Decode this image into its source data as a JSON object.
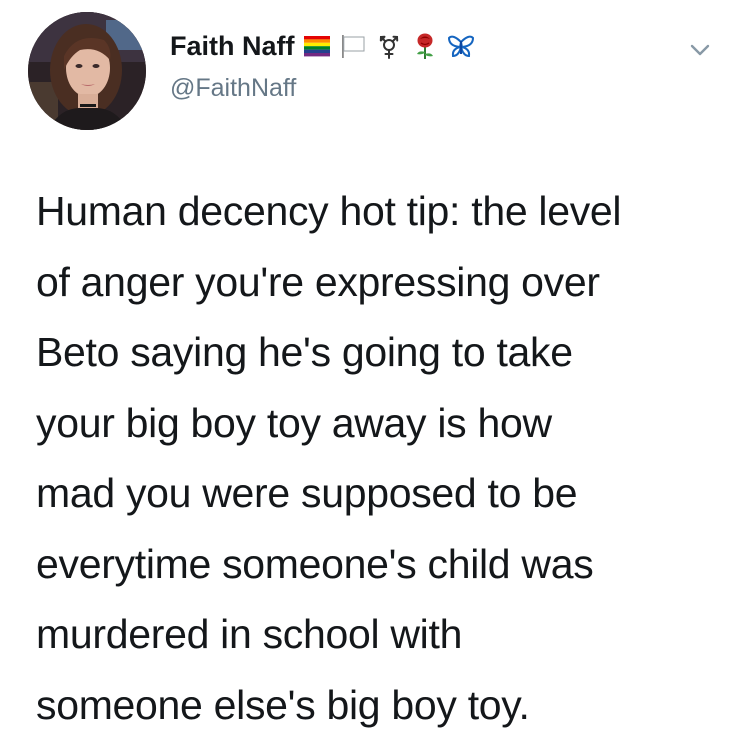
{
  "tweet": {
    "author": {
      "display_name": "Faith Naff",
      "handle": "@FaithNaff",
      "name_emojis": [
        "rainbow-flag-icon",
        "white-flag-icon",
        "transgender-symbol-icon",
        "rose-icon",
        "butterfly-icon"
      ]
    },
    "text_lines": [
      "Human decency hot tip: the level",
      "of anger you're expressing over",
      "Beto saying he's going to take",
      "your big boy toy away is how",
      "mad you were supposed to be",
      "everytime someone's child was",
      "murdered in school with",
      "someone else's big boy toy."
    ]
  },
  "colors": {
    "text": "#14171a",
    "handle": "#657786",
    "background": "#ffffff"
  }
}
